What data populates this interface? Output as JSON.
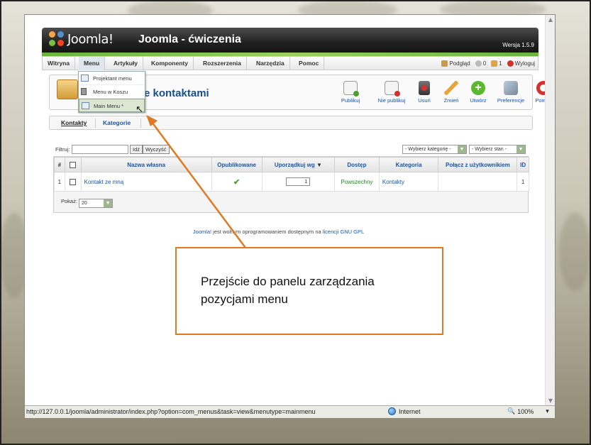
{
  "joomla": {
    "logo_text": "Joomla!",
    "site_title": "Joomla - ćwiczenia",
    "version": "Wersja 1.5.9"
  },
  "menubar": {
    "items": [
      "Witryna",
      "Menu",
      "Artykuły",
      "Komponenty",
      "Rozszerzenia",
      "Narzędzia",
      "Pomoc"
    ],
    "preview": "Podgląd",
    "messages_count": "0",
    "users_count": "1",
    "logout": "Wyloguj"
  },
  "dropdown": {
    "items": [
      "Projektant menu",
      "Menu w Koszu",
      "Main Menu *"
    ]
  },
  "toolbar": {
    "page_title": "e kontaktami",
    "buttons": [
      "Publikuj",
      "Nie publikuj",
      "Usuń",
      "Zmień",
      "Utwórz",
      "Preferencje",
      "Pomoc"
    ]
  },
  "subnav": {
    "items": [
      "Kontakty",
      "Kategorie"
    ]
  },
  "filter": {
    "label": "Filtruj:",
    "go": "Idź",
    "reset": "Wyczyść",
    "category_select": "- Wybierz kategorię -",
    "state_select": "- Wybierz stan -"
  },
  "table": {
    "headers": [
      "#",
      "",
      "Nazwa własna",
      "Opublikowane",
      "Uporządkuj wg",
      "Dostęp",
      "Kategoria",
      "Połącz z użytkownikiem",
      "ID"
    ],
    "rows": [
      {
        "num": "1",
        "name": "Kontakt ze mną",
        "published": "✔",
        "order": "1",
        "access": "Powszechny",
        "category": "Kontakty",
        "linked_user": "",
        "id": "1"
      }
    ],
    "show_label": "Pokaż:",
    "show_value": "20"
  },
  "footer": {
    "brand": "Joomla!",
    "text": " jest wolnym oprogramowaniem dostępnym na ",
    "license": "licencji GNU GPL"
  },
  "statusbar": {
    "url": "http://127.0.0.1/joomla/administrator/index.php?option=com_menus&task=view&menutype=mainmenu",
    "zone": "Internet",
    "zoom": "100%"
  },
  "callout": {
    "line1": "Przejście do panelu zarządzania",
    "line2": "pozycjami menu"
  },
  "colors": {
    "accent_orange": "#e07a22",
    "joomla_green": "#6bb43a",
    "link_blue": "#1a55a5"
  }
}
